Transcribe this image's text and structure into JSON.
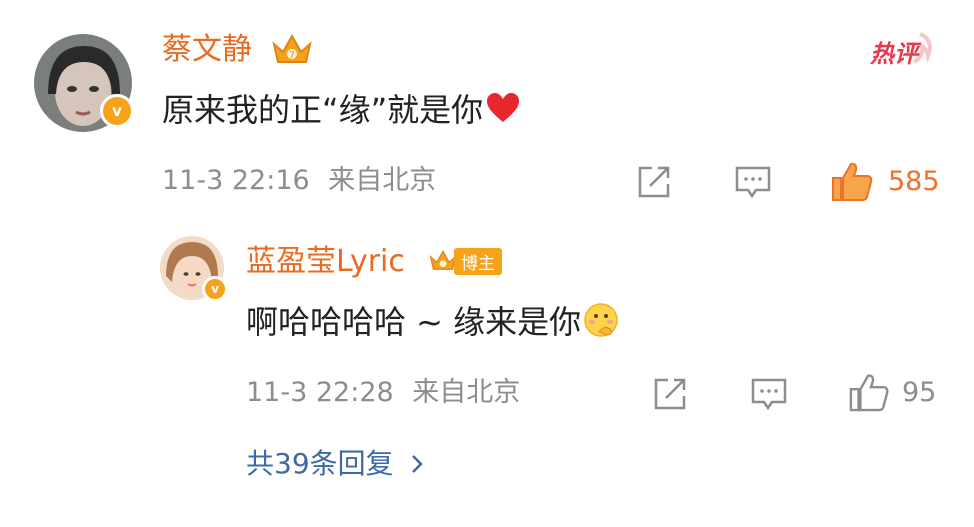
{
  "comment": {
    "author": "蔡文静",
    "text": "原来我的正“缘”就是你",
    "time": "11-3 22:16",
    "location": "来自北京",
    "likes": "585",
    "hot_badge": "热评"
  },
  "reply": {
    "author": "蓝盈莹Lyric",
    "role_badge": "博主",
    "text": "啊哈哈哈哈 ~ 缘来是你",
    "time": "11-3 22:28",
    "location": "来自北京",
    "likes": "95"
  },
  "more_replies": "共39条回复",
  "colors": {
    "name": "#e86b1f",
    "badge": "#f7a21b",
    "like_active": "#f0712b",
    "link": "#3b6aa8",
    "meta": "#8d8d8d"
  },
  "icons": [
    "crown-icon",
    "verified-icon",
    "heart-emoji",
    "share-icon",
    "comment-icon",
    "like-icon",
    "thinking-emoji",
    "chevron-right-icon"
  ]
}
